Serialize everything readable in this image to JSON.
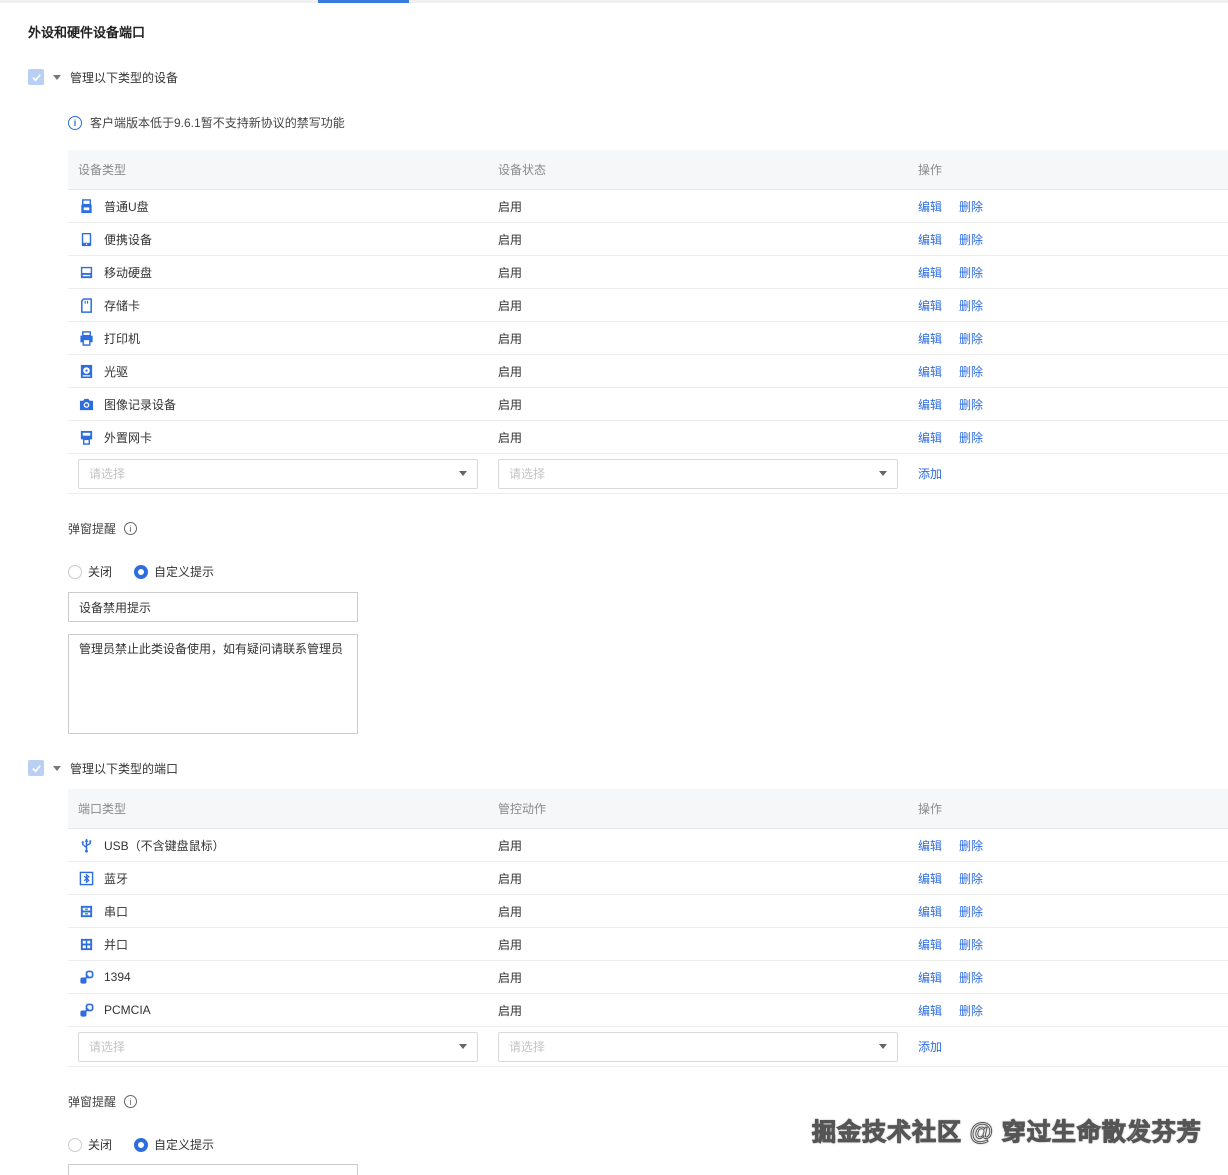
{
  "section_title": "外设和硬件设备端口",
  "devices_section": {
    "checkbox_label": "管理以下类型的设备",
    "notice": "客户端版本低于9.6.1暂不支持新协议的禁写功能",
    "headers": [
      "设备类型",
      "设备状态",
      "操作"
    ],
    "rows": [
      {
        "icon": "usb-drive-icon",
        "name": "普通U盘",
        "status": "启用"
      },
      {
        "icon": "mobile-device-icon",
        "name": "便携设备",
        "status": "启用"
      },
      {
        "icon": "external-disk-icon",
        "name": "移动硬盘",
        "status": "启用"
      },
      {
        "icon": "memory-card-icon",
        "name": "存储卡",
        "status": "启用"
      },
      {
        "icon": "printer-icon",
        "name": "打印机",
        "status": "启用"
      },
      {
        "icon": "optical-drive-icon",
        "name": "光驱",
        "status": "启用"
      },
      {
        "icon": "camera-icon",
        "name": "图像记录设备",
        "status": "启用"
      },
      {
        "icon": "network-card-icon",
        "name": "外置网卡",
        "status": "启用"
      }
    ],
    "edit_label": "编辑",
    "delete_label": "删除",
    "select_placeholder": "请选择",
    "add_label": "添加",
    "popup_label": "弹窗提醒",
    "radio_off": "关闭",
    "radio_custom": "自定义提示",
    "title_value": "设备禁用提示",
    "message_value": "管理员禁止此类设备使用，如有疑问请联系管理员"
  },
  "ports_section": {
    "checkbox_label": "管理以下类型的端口",
    "headers": [
      "端口类型",
      "管控动作",
      "操作"
    ],
    "rows": [
      {
        "icon": "usb-icon",
        "name": "USB（不含键盘鼠标）",
        "status": "启用"
      },
      {
        "icon": "bluetooth-icon",
        "name": "蓝牙",
        "status": "启用"
      },
      {
        "icon": "serial-port-icon",
        "name": "串口",
        "status": "启用"
      },
      {
        "icon": "parallel-port-icon",
        "name": "并口",
        "status": "启用"
      },
      {
        "icon": "link-icon",
        "name": "1394",
        "status": "启用"
      },
      {
        "icon": "link-icon",
        "name": "PCMCIA",
        "status": "启用"
      }
    ],
    "edit_label": "编辑",
    "delete_label": "删除",
    "select_placeholder": "请选择",
    "add_label": "添加",
    "popup_label": "弹窗提醒",
    "radio_off": "关闭",
    "radio_custom": "自定义提示"
  },
  "watermark": "掘金技术社区 @ 穿过生命散发芬芳",
  "colors": {
    "accent": "#2d6de0",
    "checkbox": "#b8d0f3",
    "header_bg": "#f6f7f9"
  }
}
